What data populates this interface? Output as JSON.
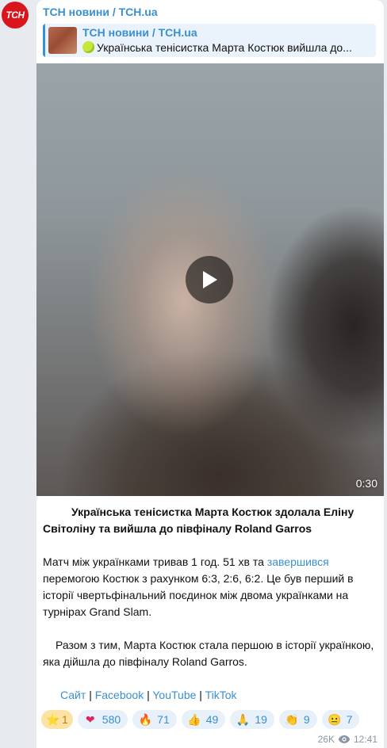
{
  "avatar": {
    "text": "ТСН"
  },
  "channel": {
    "name": "ТСН новини / TCH.ua"
  },
  "reply": {
    "title": "ТСН новини / TCH.ua",
    "text": "Українська тенісистка Марта Костюк вийшла до..."
  },
  "video": {
    "duration": "0:30"
  },
  "post": {
    "headline": "Українська тенісистка Марта Костюк здолала Еліну Світоліну та вийшла до півфіналу Roland Garros",
    "para1_a": "Матч між українками тривав 1 год. 51 хв та ",
    "para1_link": "завершився",
    "para1_b": " перемогою Костюк з рахунком 6:3, 2:6, 6:2. Це був перший в історії чвертьфінальний поєдинок між двома українками на турнірах Grand Slam.",
    "para2": "Разом з тим, Марта Костюк стала першою в історії українкою, яка дійшла до півфіналу Roland Garros.",
    "links": [
      "Сайт",
      "Facebook",
      "YouTube",
      "TikTok"
    ],
    "separator": "|"
  },
  "reactions": [
    {
      "icon": "star-icon",
      "glyph": "⭐",
      "count": "1"
    },
    {
      "icon": "heart-icon",
      "glyph": "❤",
      "count": "580"
    },
    {
      "icon": "fire-icon",
      "glyph": "🔥",
      "count": "71"
    },
    {
      "icon": "thumbs-up-icon",
      "glyph": "👍",
      "count": "49"
    },
    {
      "icon": "pray-icon",
      "glyph": "🙏",
      "count": "19"
    },
    {
      "icon": "clap-icon",
      "glyph": "👏",
      "count": "9"
    },
    {
      "icon": "smile-icon",
      "glyph": "😐",
      "count": "7"
    }
  ],
  "meta": {
    "views": "26K",
    "time": "12:41"
  },
  "colors": {
    "accent": "#3a8fd1",
    "brand": "#d9161c",
    "background": "#e7ebf0"
  }
}
